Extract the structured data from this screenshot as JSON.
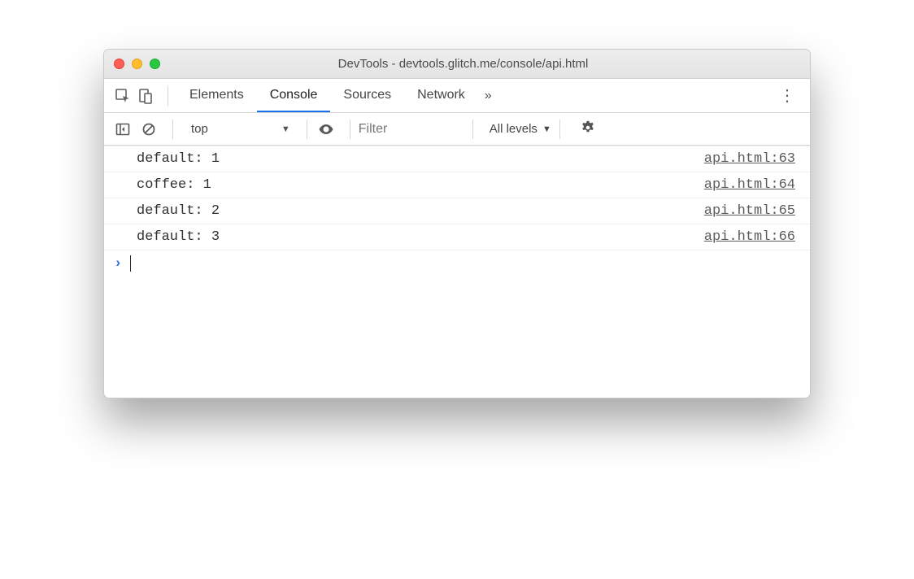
{
  "window": {
    "title": "DevTools - devtools.glitch.me/console/api.html"
  },
  "tabs": {
    "elements": "Elements",
    "console": "Console",
    "sources": "Sources",
    "network": "Network"
  },
  "overflow_glyph": "»",
  "filterbar": {
    "context": "top",
    "filter_placeholder": "Filter",
    "levels_label": "All levels"
  },
  "logs": [
    {
      "text": "default: 1",
      "source": "api.html:63"
    },
    {
      "text": "coffee: 1",
      "source": "api.html:64"
    },
    {
      "text": "default: 2",
      "source": "api.html:65"
    },
    {
      "text": "default: 3",
      "source": "api.html:66"
    }
  ]
}
